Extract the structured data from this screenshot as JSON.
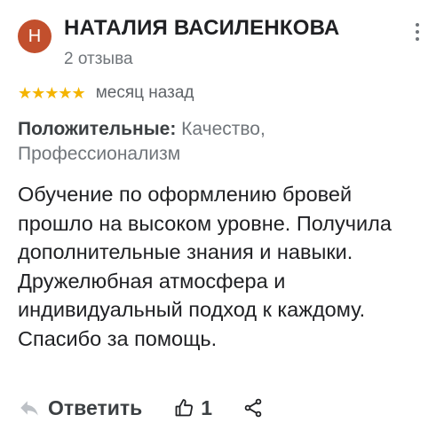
{
  "review": {
    "avatar_letter": "Н",
    "avatar_color": "#c24f2d",
    "author_name": "НАТАЛИЯ ВАСИЛЕНКОВА",
    "review_count": "2 отзыва",
    "rating": 5,
    "stars": "★★★★★",
    "date": "месяц назад",
    "positive_label": "Положительные:",
    "positive_text": "Качество, Профессионализм",
    "text": "Обучение по оформлению бровей прошло на высоком уровне. Получила дополнительные знания и навыки. Дружелюбная атмосфера и индивидуальный подход к каждому. Спасибо за помощь."
  },
  "actions": {
    "reply_label": "Ответить",
    "like_count": "1"
  },
  "icons": {
    "more": "more-vert-icon",
    "reply": "reply-arrow-icon",
    "like": "thumbs-up-icon",
    "share": "share-icon"
  }
}
